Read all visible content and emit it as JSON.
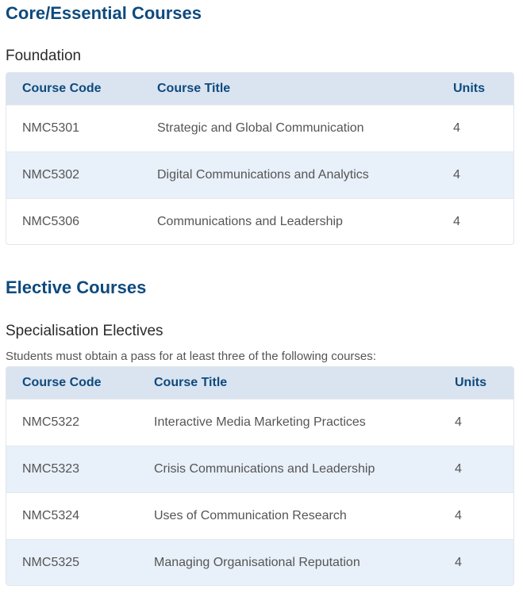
{
  "core": {
    "heading": "Core/Essential Courses",
    "group_title": "Foundation",
    "headers": {
      "code": "Course Code",
      "title": "Course Title",
      "units": "Units"
    },
    "rows": [
      {
        "code": "NMC5301",
        "title": "Strategic and Global Communication",
        "units": "4"
      },
      {
        "code": "NMC5302",
        "title": "Digital Communications and Analytics",
        "units": "4"
      },
      {
        "code": "NMC5306",
        "title": "Communications and Leadership",
        "units": "4"
      }
    ]
  },
  "elective": {
    "heading": "Elective Courses",
    "group_title": "Specialisation Electives",
    "note": "Students must obtain a pass for at least three of the following courses:",
    "headers": {
      "code": "Course Code",
      "title": "Course Title",
      "units": "Units"
    },
    "rows": [
      {
        "code": "NMC5322",
        "title": "Interactive Media Marketing Practices",
        "units": "4"
      },
      {
        "code": "NMC5323",
        "title": "Crisis Communications and Leadership",
        "units": "4"
      },
      {
        "code": "NMC5324",
        "title": "Uses of Communication Research",
        "units": "4"
      },
      {
        "code": "NMC5325",
        "title": "Managing Organisational Reputation",
        "units": "4"
      }
    ]
  },
  "colors": {
    "heading": "#0e4a7e",
    "table_header_bg": "#dae4f0",
    "row_alt_bg": "#e8f0f9"
  }
}
